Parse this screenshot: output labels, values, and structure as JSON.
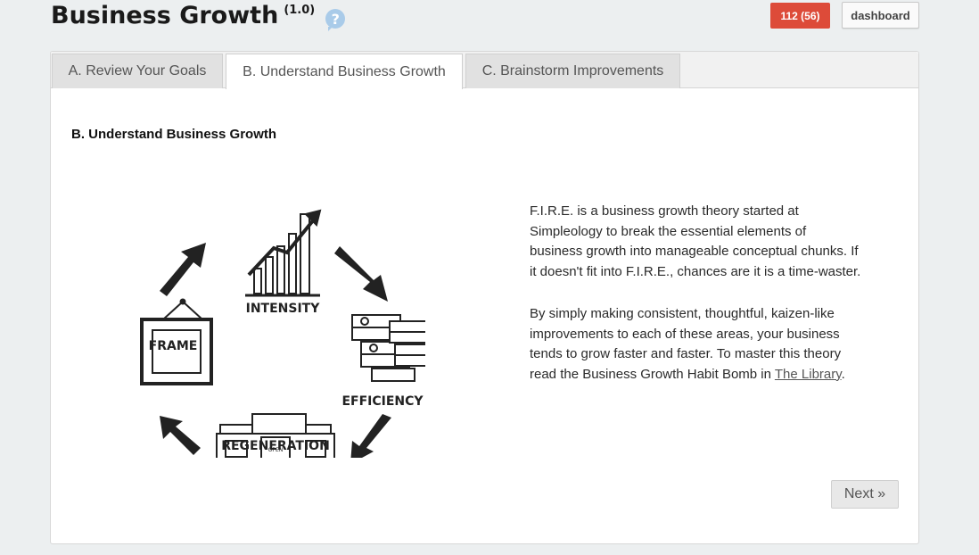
{
  "header": {
    "title": "Business Growth",
    "version": "(1.0)",
    "help_symbol": "?",
    "count_badge": "112 (56)",
    "dashboard_label": "dashboard"
  },
  "tabs": [
    {
      "label": "A. Review Your Goals"
    },
    {
      "label": "B. Understand Business Growth"
    },
    {
      "label": "C. Brainstorm Improvements"
    }
  ],
  "main": {
    "heading": "B. Understand Business Growth",
    "diagram": {
      "intensity": "INTENSITY",
      "efficiency": "EFFICIENCY",
      "regeneration": "REGENERATION",
      "frame": "FRAME",
      "open_sign": "OPEN"
    },
    "paragraph1": "F.I.R.E. is a business growth theory started at Simpleology to break the essential elements of business growth into manageable conceptual chunks. If it doesn't fit into F.I.R.E., chances are it is a time-waster.",
    "paragraph2_text": "By simply making consistent, thoughtful, kaizen-like improvements to each of these areas, your business tends to grow faster and faster. To master this theory read the Business Growth Habit Bomb in ",
    "library_link": "The Library",
    "paragraph2_end": ".",
    "next_label": "Next »"
  },
  "colors": {
    "badge": "#dd4b39",
    "help_icon": "#a9cbe9",
    "background": "#eceff0"
  }
}
